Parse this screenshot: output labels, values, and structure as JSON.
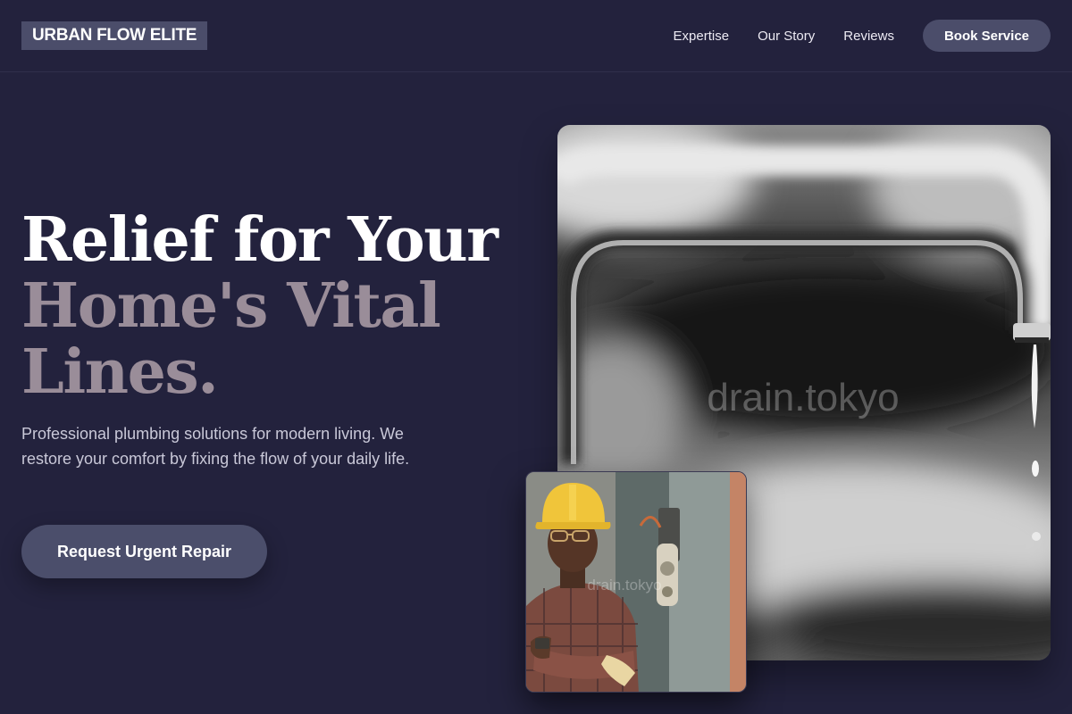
{
  "header": {
    "logo": "URBAN FLOW ELITE",
    "nav": [
      "Expertise",
      "Our Story",
      "Reviews"
    ],
    "cta": "Book Service"
  },
  "hero": {
    "headline_line1": "Relief for Your",
    "headline_line2": "Home's Vital",
    "headline_line3": "Lines.",
    "subtext": "Professional plumbing solutions for modern living. We restore your comfort by fixing the flow of your daily life.",
    "cta": "Request Urgent Repair"
  },
  "images": {
    "main_watermark": "drain.tokyo",
    "inset_watermark": "drain.tokyo"
  },
  "colors": {
    "background": "#23223d",
    "accent_button": "#4b4d6a",
    "headline_muted": "#9a8d99"
  }
}
